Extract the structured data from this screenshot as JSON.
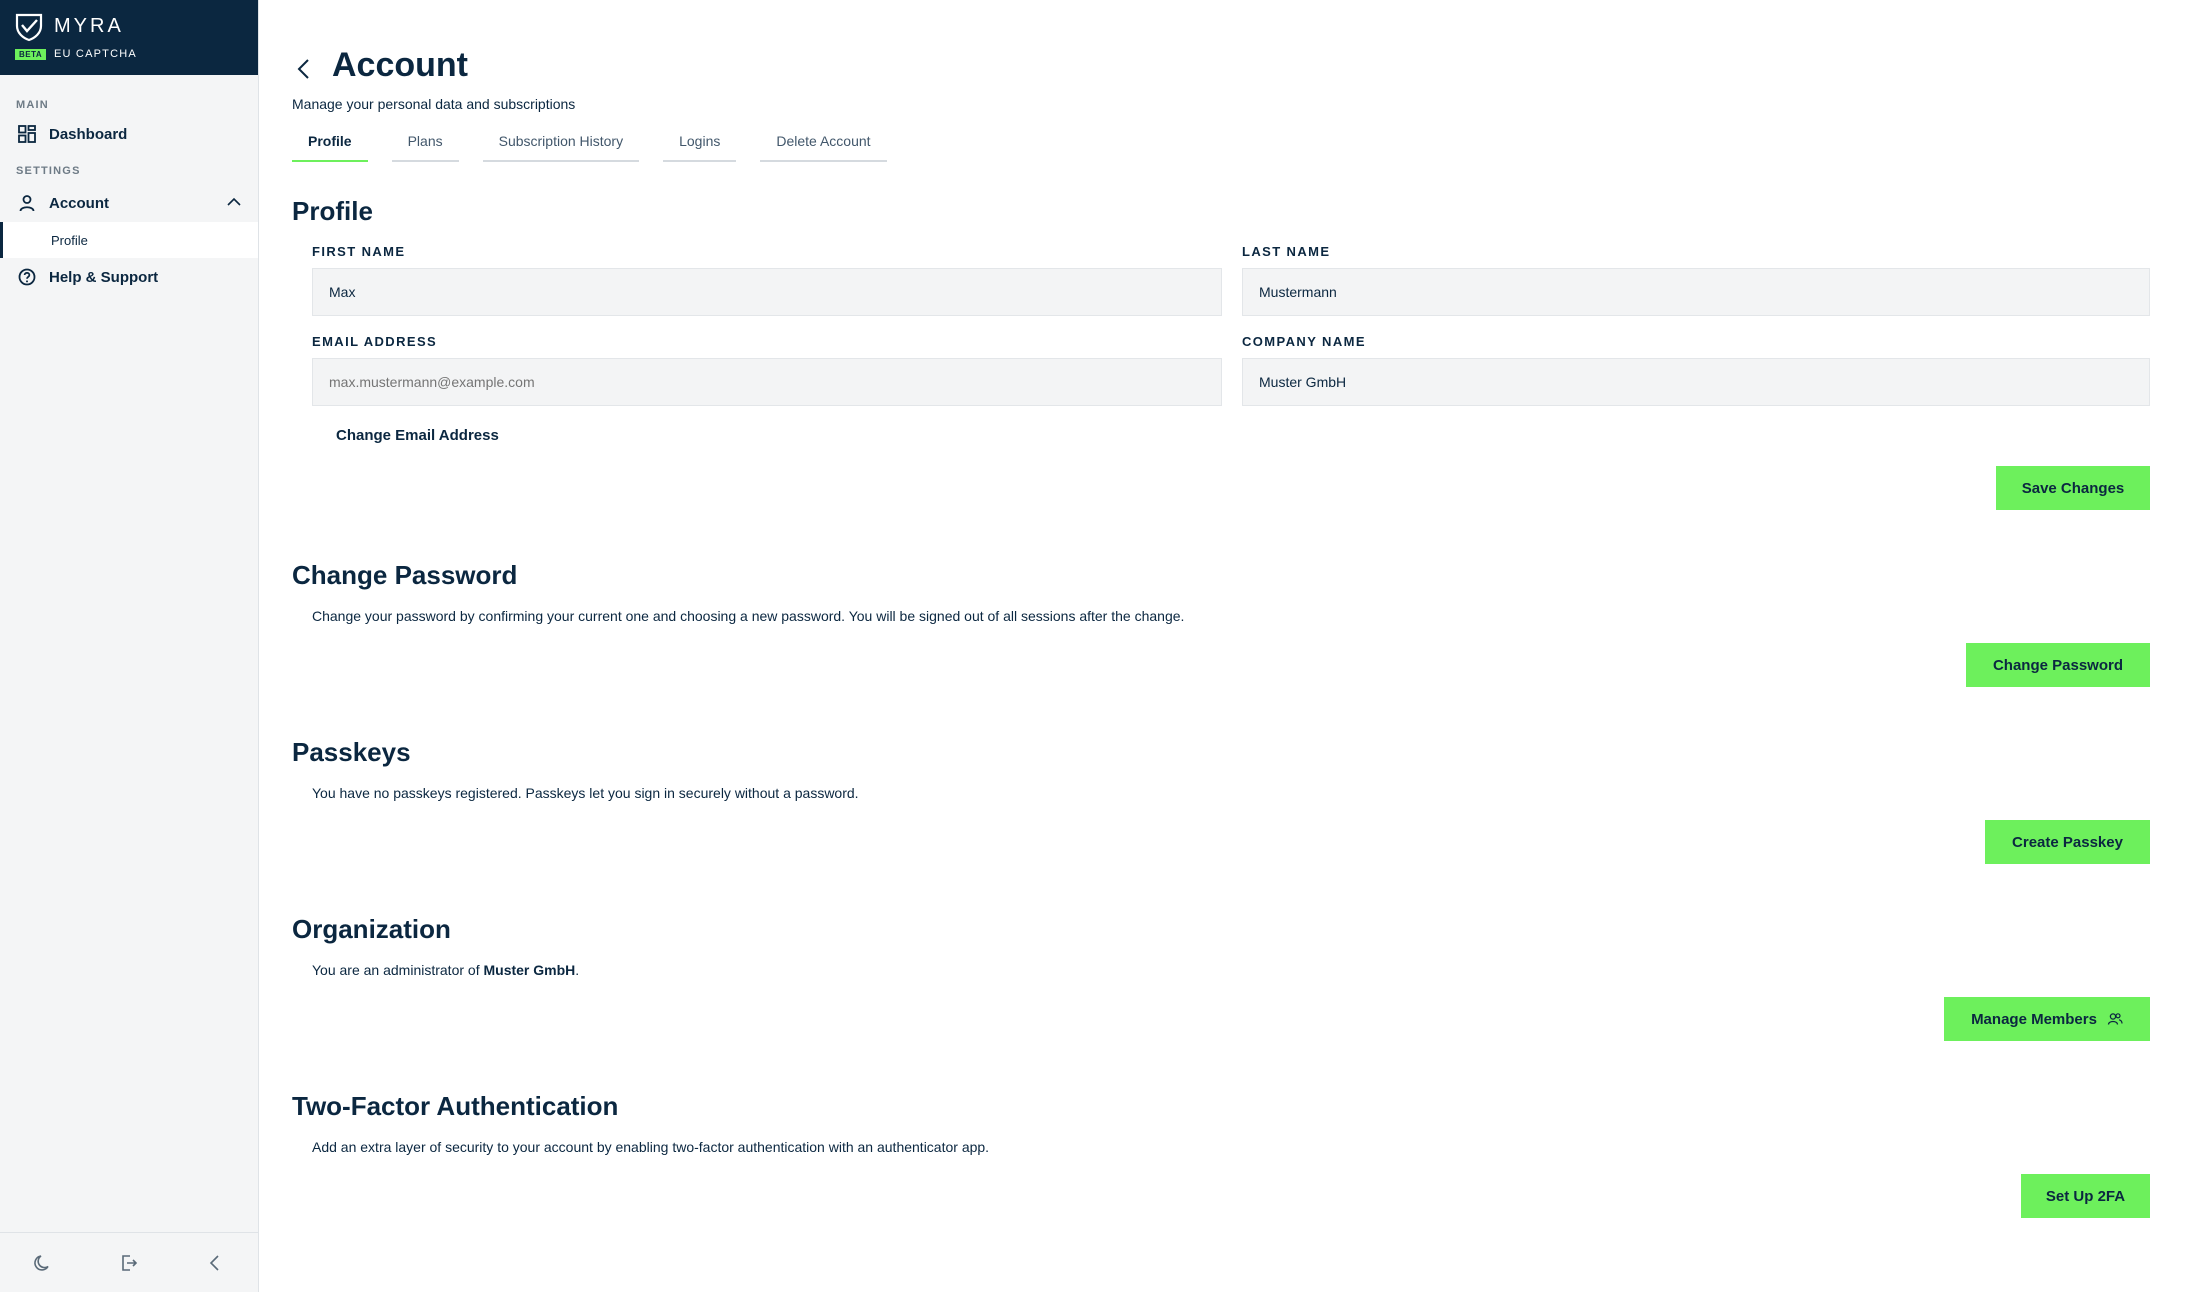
{
  "brand": {
    "name": "MYRA",
    "badge": "BETA",
    "subtitle": "EU CAPTCHA"
  },
  "sidebar": {
    "main_section": "MAIN",
    "settings_section": "SETTINGS",
    "items": {
      "dashboard": "Dashboard",
      "account": "Account",
      "profile": "Profile",
      "help": "Help & Support"
    }
  },
  "page": {
    "title": "Account",
    "subtitle": "Manage your personal data and subscriptions"
  },
  "tabs": [
    {
      "label": "Profile",
      "active": true
    },
    {
      "label": "Plans",
      "active": false
    },
    {
      "label": "Subscription History",
      "active": false
    },
    {
      "label": "Logins",
      "active": false
    },
    {
      "label": "Delete Account",
      "active": false
    }
  ],
  "profile": {
    "title": "Profile",
    "first_name_label": "FIRST NAME",
    "first_name": "Max",
    "last_name_label": "LAST NAME",
    "last_name": "Mustermann",
    "email_label": "EMAIL ADDRESS",
    "email_placeholder": "max.mustermann@example.com",
    "company_label": "COMPANY NAME",
    "company": "Muster GmbH",
    "change_email": "Change Email Address",
    "save_button": "Save Changes"
  },
  "password": {
    "title": "Change Password",
    "description": "Change your password by confirming your current one and choosing a new password. You will be signed out of all sessions after the change.",
    "button": "Change Password"
  },
  "passkeys": {
    "title": "Passkeys",
    "description": "You have no passkeys registered. Passkeys let you sign in securely without a password.",
    "button": "Create Passkey"
  },
  "organization": {
    "title": "Organization",
    "description_prefix": "You are an administrator of ",
    "org_name": "Muster GmbH",
    "description_suffix": ".",
    "button": "Manage Members"
  },
  "twofa": {
    "title": "Two-Factor Authentication",
    "description": "Add an extra layer of security to your account by enabling two-factor authentication with an authenticator app.",
    "button": "Set Up 2FA"
  },
  "colors": {
    "navy": "#0b2740",
    "accent": "#6df05c",
    "sidebar_bg": "#f4f5f6"
  },
  "icons": [
    "shield-logo-icon",
    "dashboard-grid-icon",
    "user-icon",
    "chevron-up-icon",
    "help-circle-icon",
    "back-chevron-icon",
    "moon-icon",
    "logout-icon",
    "collapse-chevron-icon",
    "users-icon"
  ]
}
